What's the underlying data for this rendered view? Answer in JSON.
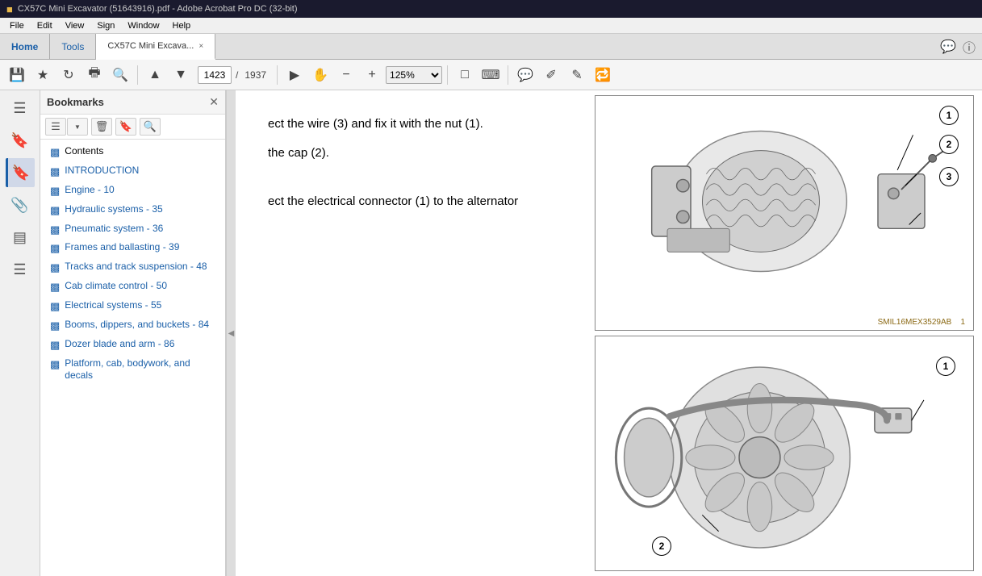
{
  "window": {
    "title": "CX57C Mini Excavator (51643916).pdf - Adobe Acrobat Pro DC (32-bit)"
  },
  "menu": {
    "items": [
      "File",
      "Edit",
      "View",
      "Sign",
      "Window",
      "Help"
    ]
  },
  "tabs": {
    "home": "Home",
    "tools": "Tools",
    "doc": "CX57C Mini Excava...",
    "close_label": "×"
  },
  "toolbar": {
    "page_current": "1423",
    "page_total": "1937",
    "zoom": "125%"
  },
  "bookmarks": {
    "title": "Bookmarks",
    "items": [
      {
        "label": "Contents",
        "selected": false
      },
      {
        "label": "INTRODUCTION",
        "selected": false
      },
      {
        "label": "Engine - 10",
        "selected": false
      },
      {
        "label": "Hydraulic systems - 35",
        "selected": false
      },
      {
        "label": "Pneumatic system - 36",
        "selected": false
      },
      {
        "label": "Frames and ballasting - 39",
        "selected": false
      },
      {
        "label": "Tracks and track suspension - 48",
        "selected": false
      },
      {
        "label": "Cab climate control - 50",
        "selected": false
      },
      {
        "label": "Electrical systems - 55",
        "selected": false
      },
      {
        "label": "Booms, dippers, and buckets - 84",
        "selected": false
      },
      {
        "label": "Dozer blade and arm - 86",
        "selected": false
      },
      {
        "label": "Platform, cab, bodywork, and decals",
        "selected": false
      }
    ]
  },
  "document": {
    "text_line1": "ect the wire (3) and fix it with the nut (1).",
    "text_line2": "the cap (2).",
    "text_line3": "ect the electrical connector (1) to the alternator",
    "img1_label": "SMIL16MEX3529AB",
    "img1_page": "1"
  }
}
